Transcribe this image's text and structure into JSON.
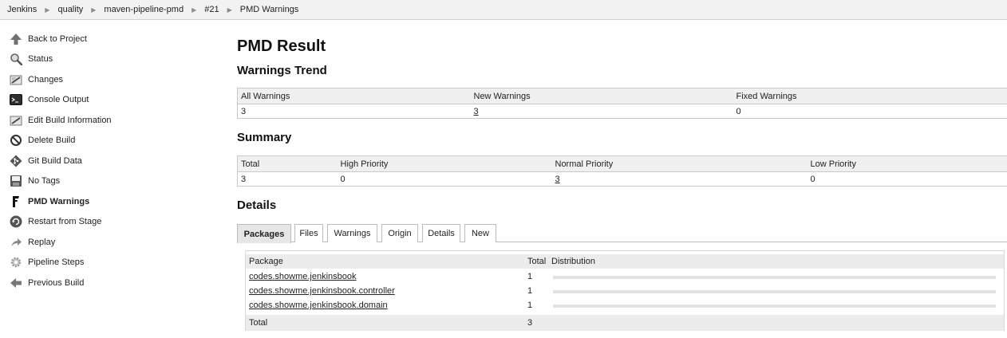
{
  "breadcrumb": [
    "Jenkins",
    "quality",
    "maven-pipeline-pmd",
    "#21",
    "PMD Warnings"
  ],
  "sidebar": {
    "items": [
      {
        "label": "Back to Project",
        "icon": "up-arrow-icon"
      },
      {
        "label": "Status",
        "icon": "magnifier-icon"
      },
      {
        "label": "Changes",
        "icon": "notepad-icon"
      },
      {
        "label": "Console Output",
        "icon": "terminal-icon"
      },
      {
        "label": "Edit Build Information",
        "icon": "notepad-edit-icon"
      },
      {
        "label": "Delete Build",
        "icon": "no-entry-icon"
      },
      {
        "label": "Git Build Data",
        "icon": "git-icon"
      },
      {
        "label": "No Tags",
        "icon": "save-icon"
      },
      {
        "label": "PMD Warnings",
        "icon": "pmd-icon",
        "active": true
      },
      {
        "label": "Restart from Stage",
        "icon": "restart-icon"
      },
      {
        "label": "Replay",
        "icon": "replay-arrow-icon"
      },
      {
        "label": "Pipeline Steps",
        "icon": "gear-icon"
      },
      {
        "label": "Previous Build",
        "icon": "left-arrow-icon"
      }
    ]
  },
  "main": {
    "title": "PMD Result",
    "trend": {
      "heading": "Warnings Trend",
      "headers": [
        "All Warnings",
        "New Warnings",
        "Fixed Warnings"
      ],
      "values": [
        "3",
        "3",
        "0"
      ]
    },
    "summary": {
      "heading": "Summary",
      "headers": [
        "Total",
        "High Priority",
        "Normal Priority",
        "Low Priority"
      ],
      "values": [
        "3",
        "0",
        "3",
        "0"
      ]
    },
    "details": {
      "heading": "Details",
      "tabs": [
        "Packages",
        "Files",
        "Warnings",
        "Origin",
        "Details",
        "New"
      ],
      "active_tab": "Packages",
      "columns": [
        "Package",
        "Total",
        "Distribution"
      ],
      "rows": [
        {
          "package": "codes.showme.jenkinsbook",
          "total": "1"
        },
        {
          "package": "codes.showme.jenkinsbook.controller",
          "total": "1"
        },
        {
          "package": "codes.showme.jenkinsbook.domain",
          "total": "1"
        }
      ],
      "footer": {
        "label": "Total",
        "total": "3"
      }
    }
  }
}
